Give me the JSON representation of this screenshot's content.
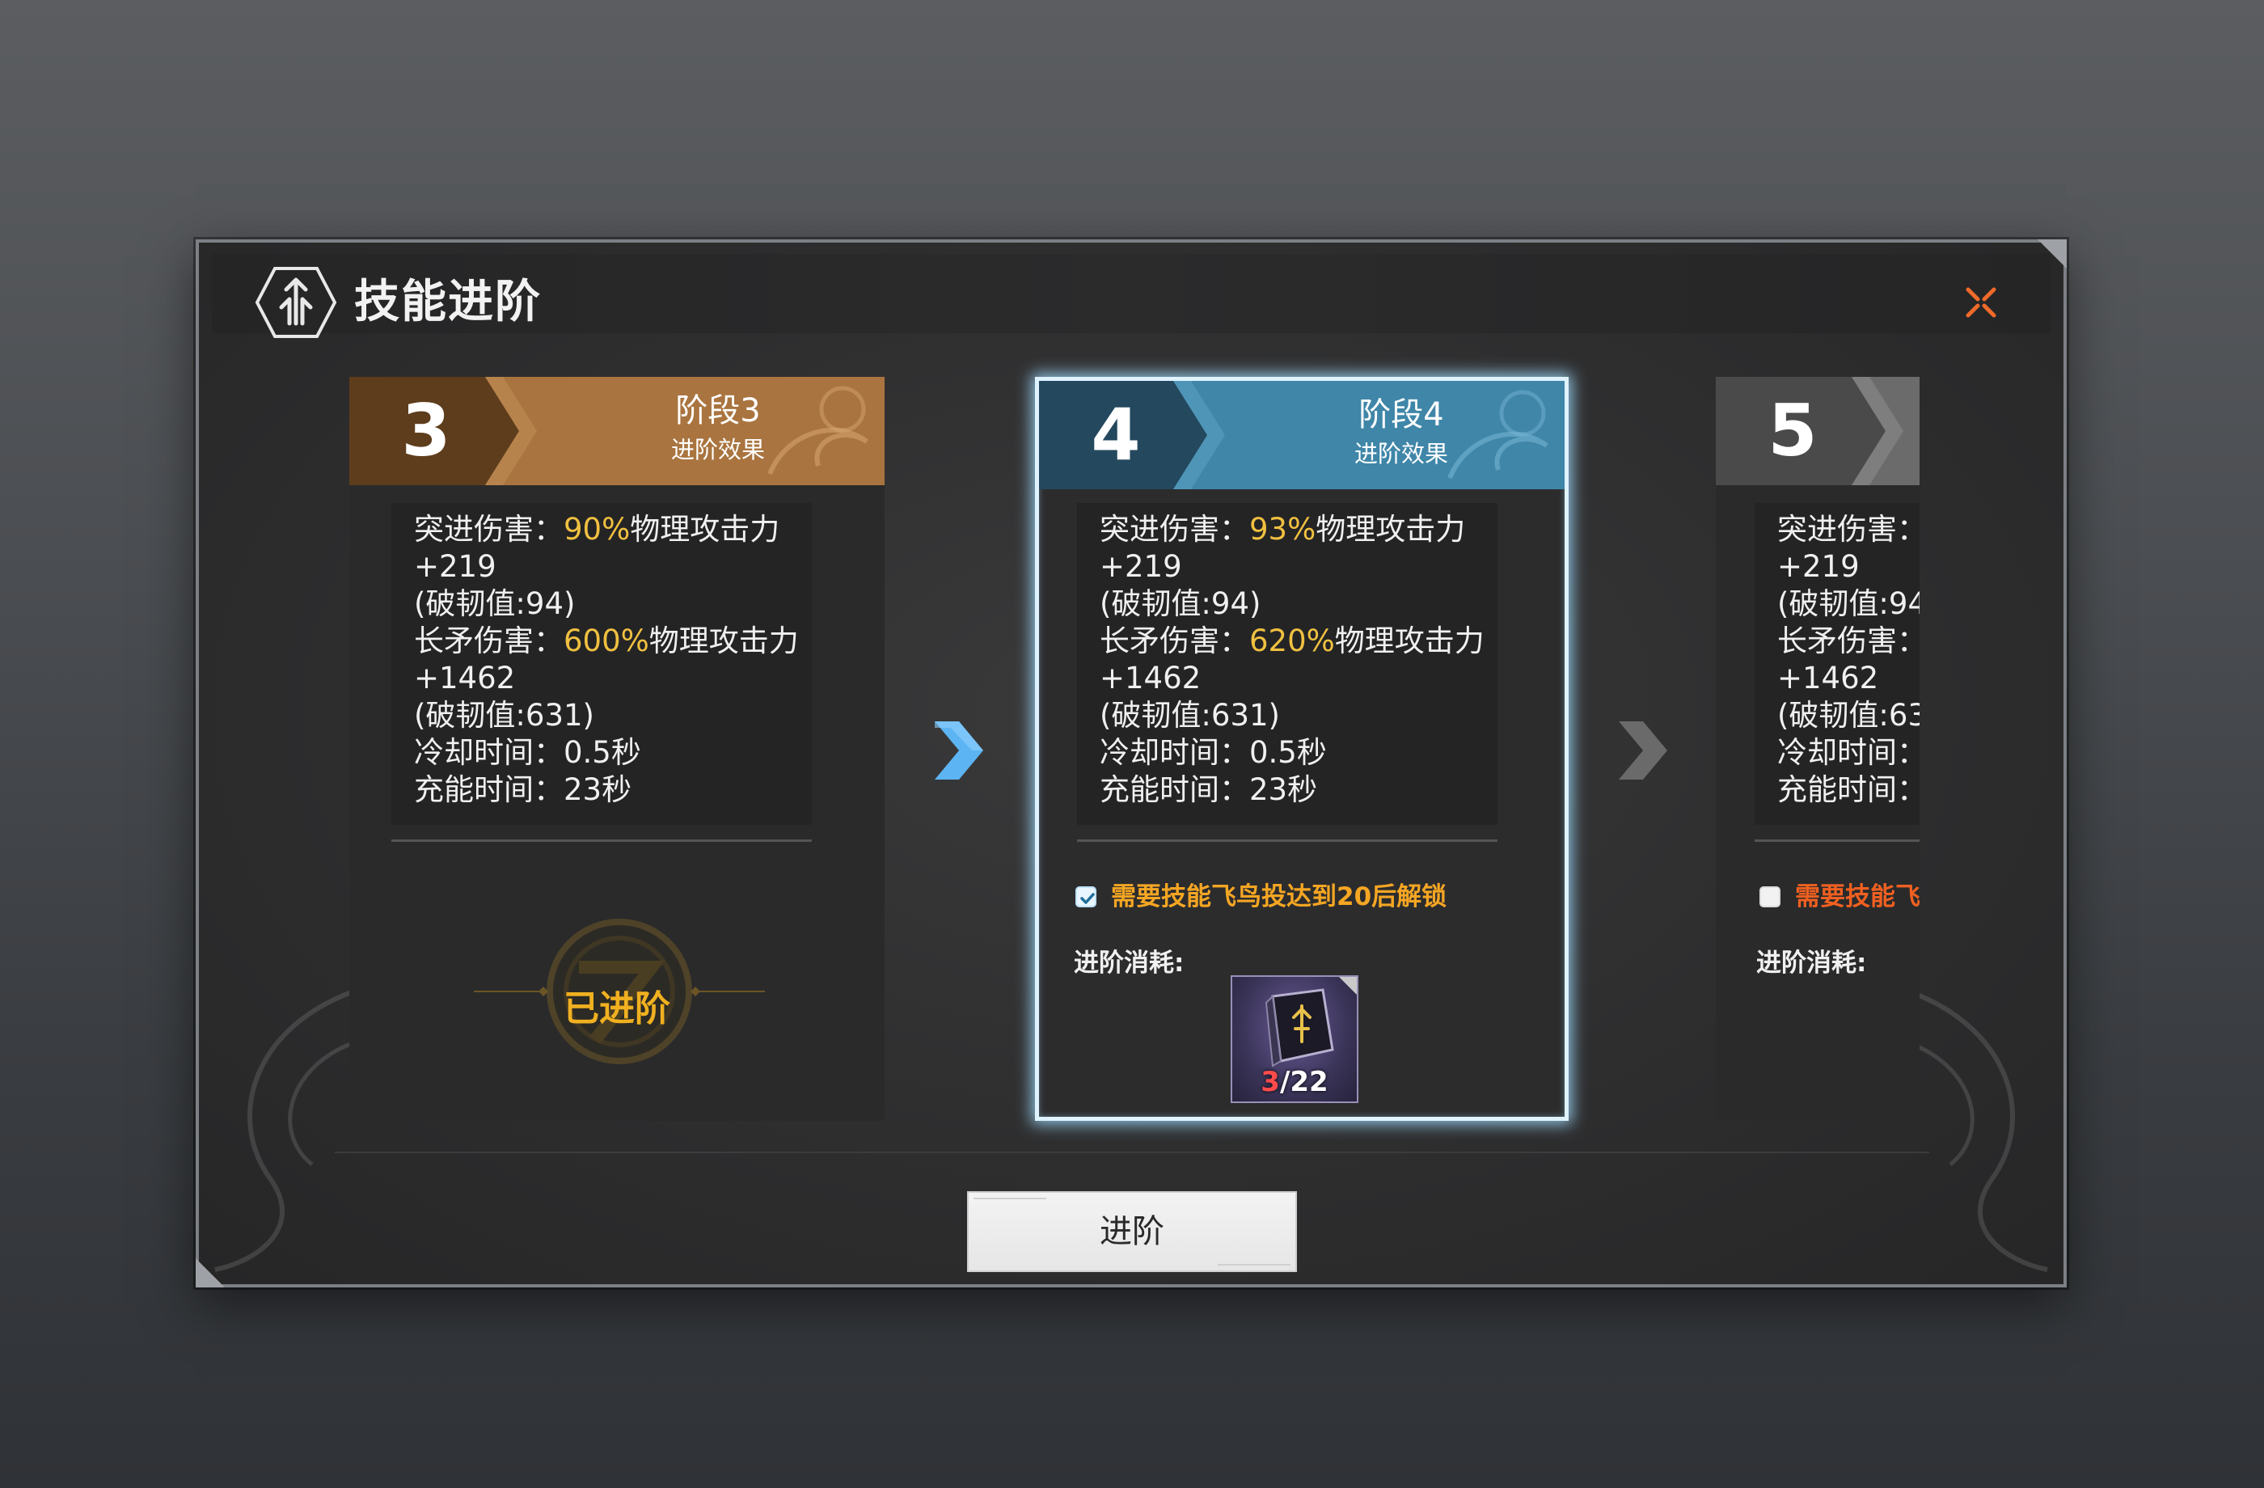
{
  "dialog": {
    "title": "技能进阶",
    "advance_button": "进阶"
  },
  "stages": [
    {
      "number": "3",
      "title": "阶段3",
      "subtitle": "进阶效果",
      "status": "advanced",
      "advanced_label": "已进阶",
      "stats": {
        "charge_label": "突进伤害：",
        "charge_pct": "90%",
        "charge_suffix": "物理攻击力",
        "charge_flat": "+219",
        "charge_break": "(破韧值:94)",
        "spear_label": "长矛伤害：",
        "spear_pct": "600%",
        "spear_suffix": "物理攻击力",
        "spear_flat": "+1462",
        "spear_break": "(破韧值:631)",
        "cooldown": "冷却时间：0.5秒",
        "recharge": "充能时间：23秒"
      }
    },
    {
      "number": "4",
      "title": "阶段4",
      "subtitle": "进阶效果",
      "status": "selected",
      "stats": {
        "charge_label": "突进伤害：",
        "charge_pct": "93%",
        "charge_suffix": "物理攻击力",
        "charge_flat": "+219",
        "charge_break": "(破韧值:94)",
        "spear_label": "长矛伤害：",
        "spear_pct": "620%",
        "spear_suffix": "物理攻击力",
        "spear_flat": "+1462",
        "spear_break": "(破韧值:631)",
        "cooldown": "冷却时间：0.5秒",
        "recharge": "充能时间：23秒"
      },
      "requirement": {
        "checked": true,
        "text": "需要技能飞鸟投达到20后解锁"
      },
      "cost_label": "进阶消耗:",
      "cost_item": {
        "have": "3",
        "need": "/22"
      }
    },
    {
      "number": "5",
      "status": "locked",
      "stats": {
        "charge_label": "突进伤害：",
        "charge_flat": "+219",
        "charge_break": "(破韧值:94",
        "spear_label": "长矛伤害：",
        "spear_flat": "+1462",
        "spear_break": "(破韧值:63",
        "cooldown": "冷却时间：",
        "recharge": "充能时间："
      },
      "requirement": {
        "checked": false,
        "text": "需要技能飞"
      },
      "cost_label": "进阶消耗:"
    }
  ],
  "colors": {
    "stage3_header": "#a9743f",
    "stage4_header": "#3f86a8",
    "stage5_header": "#4a4a4b",
    "highlight": "#f0c040",
    "requirement_text": "#f5a623",
    "close_icon": "#f06a2a",
    "arrow_active": "#5cb4f2"
  },
  "icons": {
    "title": "skill-emblem-icon",
    "close": "close-icon",
    "arrows": "chevron-right-icon",
    "checkbox": "checkmark-icon",
    "item": "skill-book-icon"
  }
}
